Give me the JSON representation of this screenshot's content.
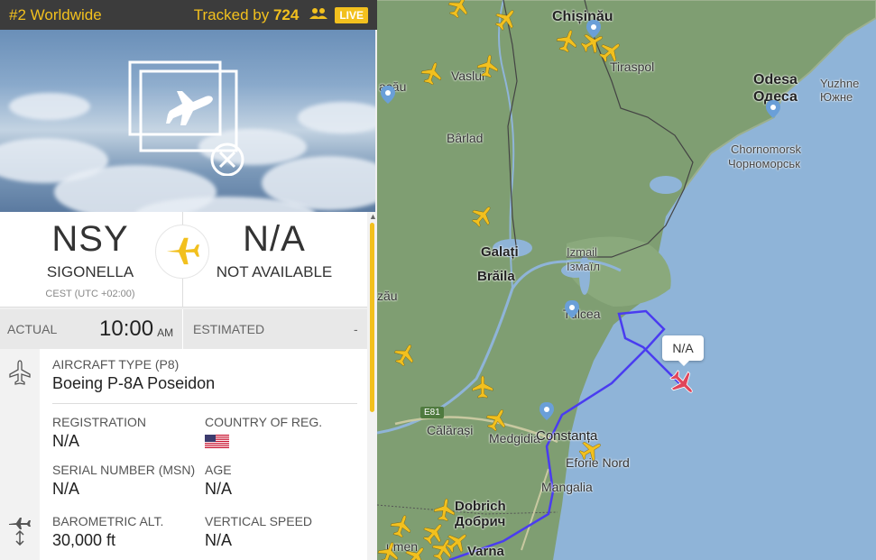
{
  "topbar": {
    "rank": "#2 Worldwide",
    "tracked_prefix": "Tracked by",
    "tracked_count": "724",
    "live_badge": "LIVE"
  },
  "route": {
    "origin": {
      "code": "NSY",
      "name": "SIGONELLA",
      "timezone": "CEST (UTC +02:00)"
    },
    "destination": {
      "code": "N/A",
      "name": "NOT AVAILABLE"
    }
  },
  "times": {
    "actual_label": "ACTUAL",
    "actual_time": "10:00",
    "actual_ampm": "AM",
    "estimated_label": "ESTIMATED",
    "estimated_value": "-"
  },
  "details": {
    "aircraft_type_label": "AIRCRAFT TYPE (P8)",
    "aircraft_type_value": "Boeing P-8A Poseidon",
    "registration_label": "REGISTRATION",
    "registration_value": "N/A",
    "country_label": "COUNTRY OF REG.",
    "serial_label": "SERIAL NUMBER (MSN)",
    "serial_value": "N/A",
    "age_label": "AGE",
    "age_value": "N/A",
    "baro_alt_label": "BAROMETRIC ALT.",
    "baro_alt_value": "30,000 ft",
    "vspeed_label": "VERTICAL SPEED",
    "vspeed_value": "N/A"
  },
  "map": {
    "callout": "N/A",
    "labels": {
      "chisinau": "Chișinău",
      "tiraspol": "Tiraspol",
      "odesa": "Odesa",
      "odesa_cyr": "Одеса",
      "yuzhne": "Yuzhne",
      "yuzhne_cyr": "Южне",
      "vaslui": "Vaslui",
      "bacau": "acău",
      "barlad": "Bârlad",
      "chornomorsk": "Chornomorsk",
      "chornomorsk_cyr": "Чорноморськ",
      "galati": "Galați",
      "braila": "Brăila",
      "izmail": "Izmail",
      "izmail_cyr": "Ізмаїл",
      "focsani": "zău",
      "tulcea": "Tulcea",
      "e81": "E81",
      "calarasi": "Călărași",
      "medgidia": "Medgidia",
      "constanta": "Constanța",
      "eforie": "Eforie Nord",
      "mangalia": "Mangalia",
      "dobrich": "Dobrich",
      "dobrich_cyr": "Добрич",
      "varna": "Varna",
      "shumen": "umen"
    }
  },
  "colors": {
    "accent": "#f2c01e",
    "topbar_bg": "#3c3c3c",
    "track": "#4a3cf0",
    "selected_plane": "#e0455a",
    "traffic_plane": "#f2c01e",
    "sea": "#8fb4d8",
    "land": "#7f9e72"
  },
  "icons": {
    "people": "people-icon",
    "route_plane": "airplane-icon",
    "no_photo": "no-photo-icon",
    "aircraft_side": "airplane-icon",
    "altitude_side": "altitude-icon",
    "flag": "us-flag-icon"
  }
}
